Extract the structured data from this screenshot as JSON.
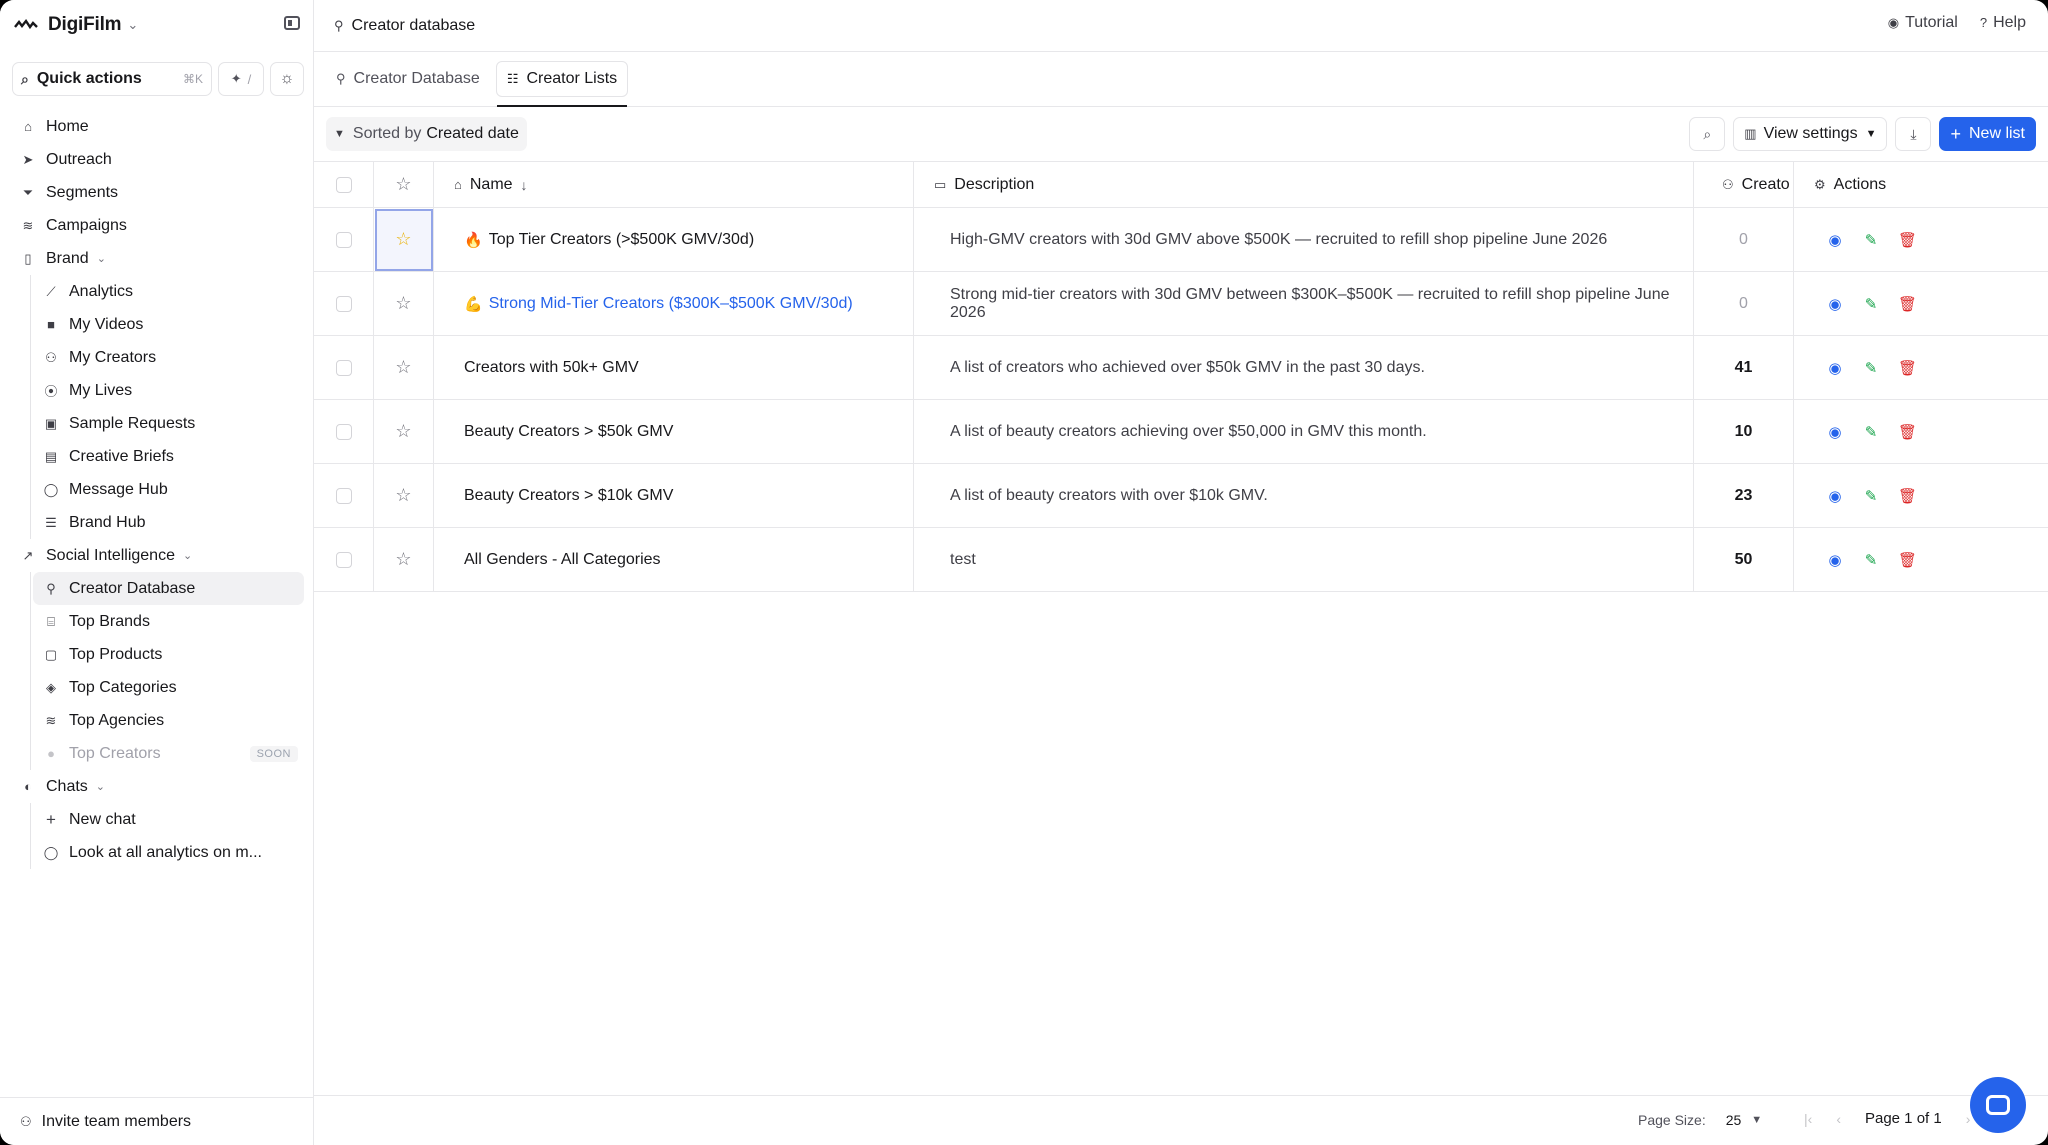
{
  "app": {
    "name": "DigiFilm"
  },
  "quick_actions": {
    "label": "Quick actions",
    "shortcut": "⌘K",
    "slash": "/"
  },
  "nav": {
    "home": "Home",
    "outreach": "Outreach",
    "segments": "Segments",
    "campaigns": "Campaigns",
    "brand": "Brand",
    "brand_items": [
      "Analytics",
      "My Videos",
      "My Creators",
      "My Lives",
      "Sample Requests",
      "Creative Briefs",
      "Message Hub",
      "Brand Hub"
    ],
    "social_intelligence": "Social Intelligence",
    "si_items": [
      "Creator Database",
      "Top Brands",
      "Top Products",
      "Top Categories",
      "Top Agencies",
      "Top Creators"
    ],
    "soon_badge": "SOON",
    "chats": "Chats",
    "chat_items": [
      "New chat",
      "Look at all analytics on m..."
    ],
    "invite": "Invite team members"
  },
  "header": {
    "title": "Creator database",
    "tutorial": "Tutorial",
    "help": "Help"
  },
  "tabs": [
    "Creator Database",
    "Creator Lists"
  ],
  "toolbar": {
    "sorted_by": "Sorted by",
    "sort_field": "Created date",
    "view_settings": "View settings",
    "new_list": "New list"
  },
  "table": {
    "headers": {
      "name": "Name",
      "description": "Description",
      "count": "Creato",
      "actions": "Actions"
    },
    "rows": [
      {
        "emoji": "🔥",
        "name": "Top Tier Creators (>$500K GMV/30d)",
        "description": "High-GMV creators with 30d GMV above $500K — recruited to refill shop pipeline June 2026",
        "count": "0"
      },
      {
        "emoji": "💪",
        "name": "Strong Mid-Tier Creators ($300K–$500K GMV/30d)",
        "description": "Strong mid-tier creators with 30d GMV between $300K–$500K — recruited to refill shop pipeline June 2026",
        "count": "0"
      },
      {
        "emoji": "",
        "name": "Creators with 50k+ GMV",
        "description": "A list of creators who achieved over $50k GMV in the past 30 days.",
        "count": "41"
      },
      {
        "emoji": "",
        "name": "Beauty Creators > $50k GMV",
        "description": "A list of beauty creators achieving over $50,000 in GMV this month.",
        "count": "10"
      },
      {
        "emoji": "",
        "name": "Beauty Creators > $10k GMV",
        "description": "A list of beauty creators with over $10k GMV.",
        "count": "23"
      },
      {
        "emoji": "",
        "name": "All Genders - All Categories",
        "description": "test",
        "count": "50"
      }
    ]
  },
  "footer": {
    "page_size_label": "Page Size:",
    "page_size": "25",
    "page_label": "Page 1 of 1"
  },
  "colors": {
    "accent": "#2563eb",
    "edit": "#16a34a",
    "delete": "#dc2626",
    "favorite": "#eab308"
  }
}
